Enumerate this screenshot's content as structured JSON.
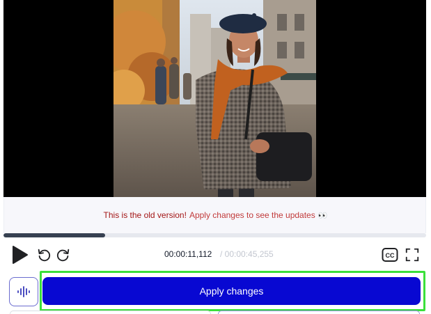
{
  "video": {
    "progress_fraction": 0.24
  },
  "notice": {
    "strong_text": "This is the old version!",
    "soft_text": "Apply changes to see the updates",
    "emoji": "👀"
  },
  "player": {
    "current_time": "00:00:11,112",
    "total_time": "/ 00:00:45,255",
    "cc_label": "CC",
    "icons": {
      "play": "play-icon",
      "rewind": "rewind-icon",
      "forward": "forward-icon",
      "captions": "closed-captions-icon",
      "fullscreen": "fullscreen-icon"
    }
  },
  "actions": {
    "apply_label": "Apply changes",
    "waveform_icon": "waveform-icon"
  },
  "colors": {
    "primary": "#0808d2",
    "highlight": "#3be03b",
    "notice_text": "#a31515",
    "progress": "#374151"
  }
}
